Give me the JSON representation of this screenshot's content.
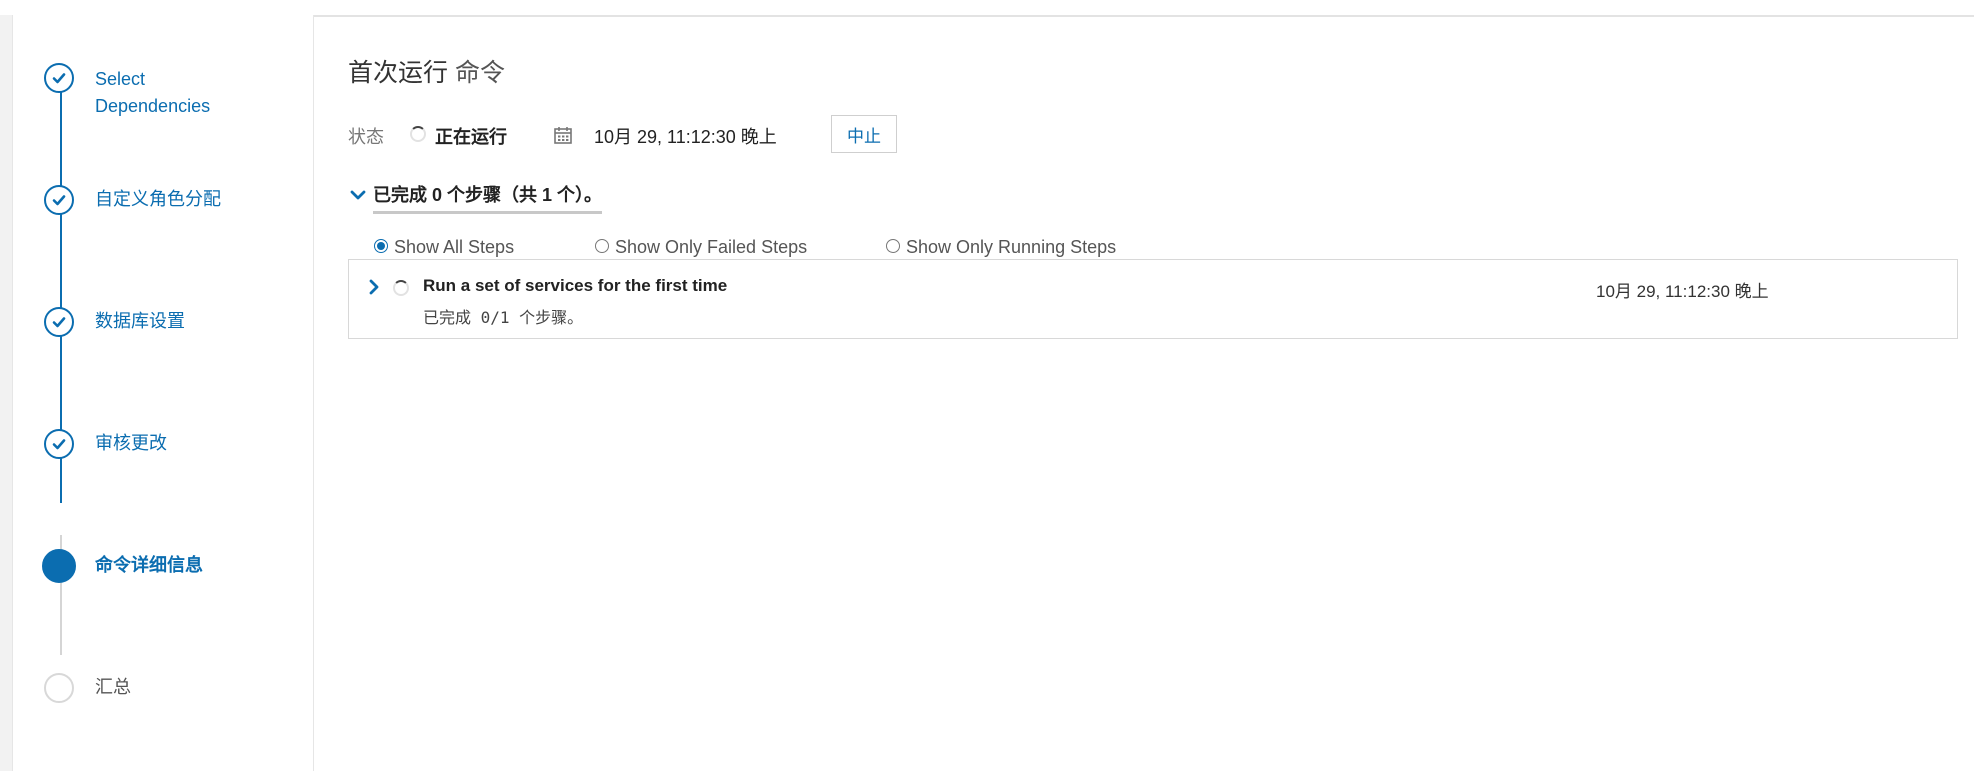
{
  "wizard": {
    "steps": [
      {
        "label_line1": "Select",
        "label_line2": "Dependencies",
        "state": "done"
      },
      {
        "label": "自定义角色分配",
        "state": "done"
      },
      {
        "label": "数据库设置",
        "state": "done"
      },
      {
        "label": "审核更改",
        "state": "done"
      },
      {
        "label": "命令详细信息",
        "state": "current"
      },
      {
        "label": "汇总",
        "state": "pending"
      }
    ]
  },
  "command": {
    "title_main": "首次运行",
    "title_sub": "命令",
    "status_label": "状态",
    "status_value": "正在运行",
    "start_time": "10月 29, 11:12:30 晚上",
    "abort_label": "中止",
    "summary": "已完成 0 个步骤（共 1 个）。"
  },
  "filters": [
    {
      "label": "Show All Steps",
      "checked": true
    },
    {
      "label": "Show Only Failed Steps",
      "checked": false
    },
    {
      "label": "Show Only Running Steps",
      "checked": false
    }
  ],
  "step_rows": [
    {
      "title": "Run a set of services for the first time",
      "progress_text": "已完成 0/1 个步骤。",
      "time": "10月 29, 11:12:30 晚上"
    }
  ],
  "colors": {
    "accent": "#0b6db0",
    "pending": "#d8d8d8"
  },
  "icons": {
    "done": "check-icon",
    "calendar": "calendar-icon",
    "collapse": "chevron-down-icon",
    "expand": "chevron-right-icon",
    "running": "spinner-icon"
  }
}
